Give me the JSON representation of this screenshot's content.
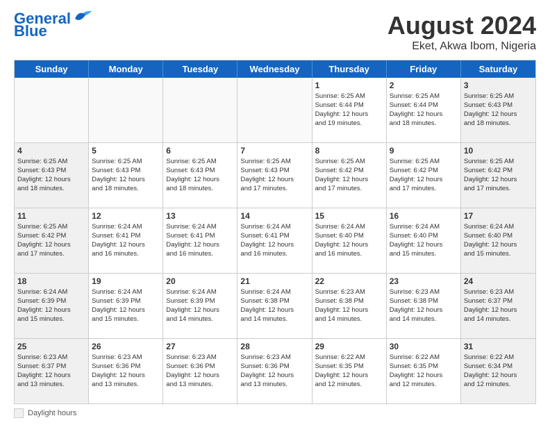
{
  "logo": {
    "line1": "General",
    "line2": "Blue"
  },
  "title": "August 2024",
  "subtitle": "Eket, Akwa Ibom, Nigeria",
  "days": [
    "Sunday",
    "Monday",
    "Tuesday",
    "Wednesday",
    "Thursday",
    "Friday",
    "Saturday"
  ],
  "footer_label": "Daylight hours",
  "weeks": [
    [
      {
        "day": "",
        "info": ""
      },
      {
        "day": "",
        "info": ""
      },
      {
        "day": "",
        "info": ""
      },
      {
        "day": "",
        "info": ""
      },
      {
        "day": "1",
        "info": "Sunrise: 6:25 AM\nSunset: 6:44 PM\nDaylight: 12 hours\nand 19 minutes."
      },
      {
        "day": "2",
        "info": "Sunrise: 6:25 AM\nSunset: 6:44 PM\nDaylight: 12 hours\nand 18 minutes."
      },
      {
        "day": "3",
        "info": "Sunrise: 6:25 AM\nSunset: 6:43 PM\nDaylight: 12 hours\nand 18 minutes."
      }
    ],
    [
      {
        "day": "4",
        "info": "Sunrise: 6:25 AM\nSunset: 6:43 PM\nDaylight: 12 hours\nand 18 minutes."
      },
      {
        "day": "5",
        "info": "Sunrise: 6:25 AM\nSunset: 6:43 PM\nDaylight: 12 hours\nand 18 minutes."
      },
      {
        "day": "6",
        "info": "Sunrise: 6:25 AM\nSunset: 6:43 PM\nDaylight: 12 hours\nand 18 minutes."
      },
      {
        "day": "7",
        "info": "Sunrise: 6:25 AM\nSunset: 6:43 PM\nDaylight: 12 hours\nand 17 minutes."
      },
      {
        "day": "8",
        "info": "Sunrise: 6:25 AM\nSunset: 6:42 PM\nDaylight: 12 hours\nand 17 minutes."
      },
      {
        "day": "9",
        "info": "Sunrise: 6:25 AM\nSunset: 6:42 PM\nDaylight: 12 hours\nand 17 minutes."
      },
      {
        "day": "10",
        "info": "Sunrise: 6:25 AM\nSunset: 6:42 PM\nDaylight: 12 hours\nand 17 minutes."
      }
    ],
    [
      {
        "day": "11",
        "info": "Sunrise: 6:25 AM\nSunset: 6:42 PM\nDaylight: 12 hours\nand 17 minutes."
      },
      {
        "day": "12",
        "info": "Sunrise: 6:24 AM\nSunset: 6:41 PM\nDaylight: 12 hours\nand 16 minutes."
      },
      {
        "day": "13",
        "info": "Sunrise: 6:24 AM\nSunset: 6:41 PM\nDaylight: 12 hours\nand 16 minutes."
      },
      {
        "day": "14",
        "info": "Sunrise: 6:24 AM\nSunset: 6:41 PM\nDaylight: 12 hours\nand 16 minutes."
      },
      {
        "day": "15",
        "info": "Sunrise: 6:24 AM\nSunset: 6:40 PM\nDaylight: 12 hours\nand 16 minutes."
      },
      {
        "day": "16",
        "info": "Sunrise: 6:24 AM\nSunset: 6:40 PM\nDaylight: 12 hours\nand 15 minutes."
      },
      {
        "day": "17",
        "info": "Sunrise: 6:24 AM\nSunset: 6:40 PM\nDaylight: 12 hours\nand 15 minutes."
      }
    ],
    [
      {
        "day": "18",
        "info": "Sunrise: 6:24 AM\nSunset: 6:39 PM\nDaylight: 12 hours\nand 15 minutes."
      },
      {
        "day": "19",
        "info": "Sunrise: 6:24 AM\nSunset: 6:39 PM\nDaylight: 12 hours\nand 15 minutes."
      },
      {
        "day": "20",
        "info": "Sunrise: 6:24 AM\nSunset: 6:39 PM\nDaylight: 12 hours\nand 14 minutes."
      },
      {
        "day": "21",
        "info": "Sunrise: 6:24 AM\nSunset: 6:38 PM\nDaylight: 12 hours\nand 14 minutes."
      },
      {
        "day": "22",
        "info": "Sunrise: 6:23 AM\nSunset: 6:38 PM\nDaylight: 12 hours\nand 14 minutes."
      },
      {
        "day": "23",
        "info": "Sunrise: 6:23 AM\nSunset: 6:38 PM\nDaylight: 12 hours\nand 14 minutes."
      },
      {
        "day": "24",
        "info": "Sunrise: 6:23 AM\nSunset: 6:37 PM\nDaylight: 12 hours\nand 14 minutes."
      }
    ],
    [
      {
        "day": "25",
        "info": "Sunrise: 6:23 AM\nSunset: 6:37 PM\nDaylight: 12 hours\nand 13 minutes."
      },
      {
        "day": "26",
        "info": "Sunrise: 6:23 AM\nSunset: 6:36 PM\nDaylight: 12 hours\nand 13 minutes."
      },
      {
        "day": "27",
        "info": "Sunrise: 6:23 AM\nSunset: 6:36 PM\nDaylight: 12 hours\nand 13 minutes."
      },
      {
        "day": "28",
        "info": "Sunrise: 6:23 AM\nSunset: 6:36 PM\nDaylight: 12 hours\nand 13 minutes."
      },
      {
        "day": "29",
        "info": "Sunrise: 6:22 AM\nSunset: 6:35 PM\nDaylight: 12 hours\nand 12 minutes."
      },
      {
        "day": "30",
        "info": "Sunrise: 6:22 AM\nSunset: 6:35 PM\nDaylight: 12 hours\nand 12 minutes."
      },
      {
        "day": "31",
        "info": "Sunrise: 6:22 AM\nSunset: 6:34 PM\nDaylight: 12 hours\nand 12 minutes."
      }
    ]
  ]
}
